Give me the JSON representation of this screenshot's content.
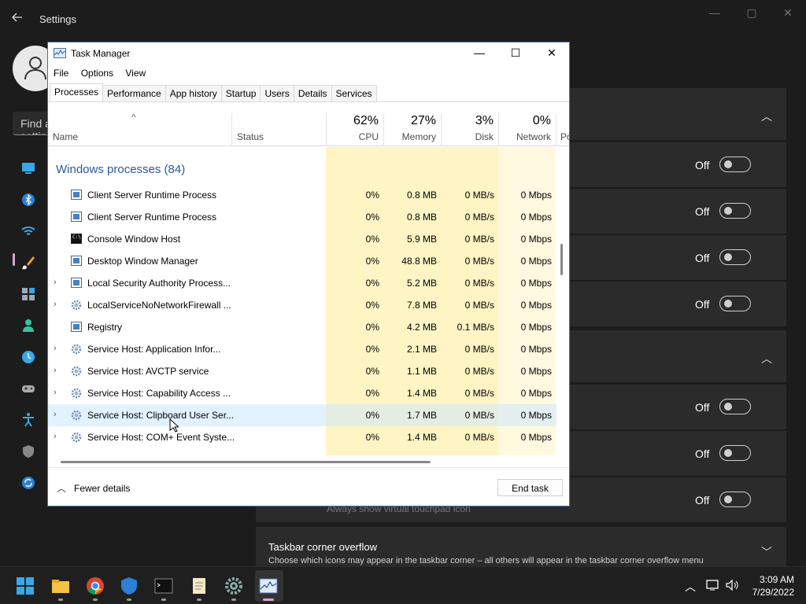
{
  "settings": {
    "title": "Settings",
    "search_placeholder": "Find a setting",
    "toggle_label": "Off",
    "hint": "Always show virtual touchpad icon",
    "overflow_title": "Taskbar corner overflow",
    "overflow_desc": "Choose which icons may appear in the taskbar corner – all others will appear in the taskbar corner overflow menu"
  },
  "taskmanager": {
    "title": "Task Manager",
    "menu": [
      "File",
      "Options",
      "View"
    ],
    "tabs": [
      "Processes",
      "Performance",
      "App history",
      "Startup",
      "Users",
      "Details",
      "Services"
    ],
    "active_tab": "Processes",
    "columns": {
      "name": "Name",
      "status": "Status",
      "cpu": {
        "pct": "62%",
        "label": "CPU"
      },
      "memory": {
        "pct": "27%",
        "label": "Memory"
      },
      "disk": {
        "pct": "3%",
        "label": "Disk"
      },
      "network": {
        "pct": "0%",
        "label": "Network"
      },
      "power": "Po"
    },
    "group_header": "Windows processes (84)",
    "rows": [
      {
        "name": "Client Server Runtime Process",
        "expandable": false,
        "icon": "window",
        "cpu": "0%",
        "memory": "0.8 MB",
        "disk": "0 MB/s",
        "network": "0 Mbps"
      },
      {
        "name": "Client Server Runtime Process",
        "expandable": false,
        "icon": "window",
        "cpu": "0%",
        "memory": "0.8 MB",
        "disk": "0 MB/s",
        "network": "0 Mbps"
      },
      {
        "name": "Console Window Host",
        "expandable": false,
        "icon": "console",
        "cpu": "0%",
        "memory": "5.9 MB",
        "disk": "0 MB/s",
        "network": "0 Mbps"
      },
      {
        "name": "Desktop Window Manager",
        "expandable": false,
        "icon": "window",
        "cpu": "0%",
        "memory": "48.8 MB",
        "disk": "0 MB/s",
        "network": "0 Mbps"
      },
      {
        "name": "Local Security Authority Process...",
        "expandable": true,
        "icon": "window",
        "cpu": "0%",
        "memory": "5.2 MB",
        "disk": "0 MB/s",
        "network": "0 Mbps"
      },
      {
        "name": "LocalServiceNoNetworkFirewall ...",
        "expandable": true,
        "icon": "gear",
        "cpu": "0%",
        "memory": "7.8 MB",
        "disk": "0 MB/s",
        "network": "0 Mbps"
      },
      {
        "name": "Registry",
        "expandable": false,
        "icon": "window",
        "cpu": "0%",
        "memory": "4.2 MB",
        "disk": "0.1 MB/s",
        "network": "0 Mbps"
      },
      {
        "name": "Service Host: Application Infor...",
        "expandable": true,
        "icon": "gear",
        "cpu": "0%",
        "memory": "2.1 MB",
        "disk": "0 MB/s",
        "network": "0 Mbps"
      },
      {
        "name": "Service Host: AVCTP service",
        "expandable": true,
        "icon": "gear",
        "cpu": "0%",
        "memory": "1.1 MB",
        "disk": "0 MB/s",
        "network": "0 Mbps"
      },
      {
        "name": "Service Host: Capability Access ...",
        "expandable": true,
        "icon": "gear",
        "cpu": "0%",
        "memory": "1.4 MB",
        "disk": "0 MB/s",
        "network": "0 Mbps"
      },
      {
        "name": "Service Host: Clipboard User Ser...",
        "expandable": true,
        "icon": "gear",
        "cpu": "0%",
        "memory": "1.7 MB",
        "disk": "0 MB/s",
        "network": "0 Mbps",
        "selected": true
      },
      {
        "name": "Service Host: COM+ Event Syste...",
        "expandable": true,
        "icon": "gear",
        "cpu": "0%",
        "memory": "1.4 MB",
        "disk": "0 MB/s",
        "network": "0 Mbps"
      }
    ],
    "fewer_details": "Fewer details",
    "end_task": "End task"
  },
  "taskbar": {
    "time": "3:09 AM",
    "date": "7/29/2022"
  },
  "colors": {
    "heat_light": "#fff9e0",
    "heat_mid": "#fff4c4",
    "heat_strong": "#ffe9a3",
    "group_header": "#2e5a9a",
    "accent": "#d9a2d0"
  }
}
